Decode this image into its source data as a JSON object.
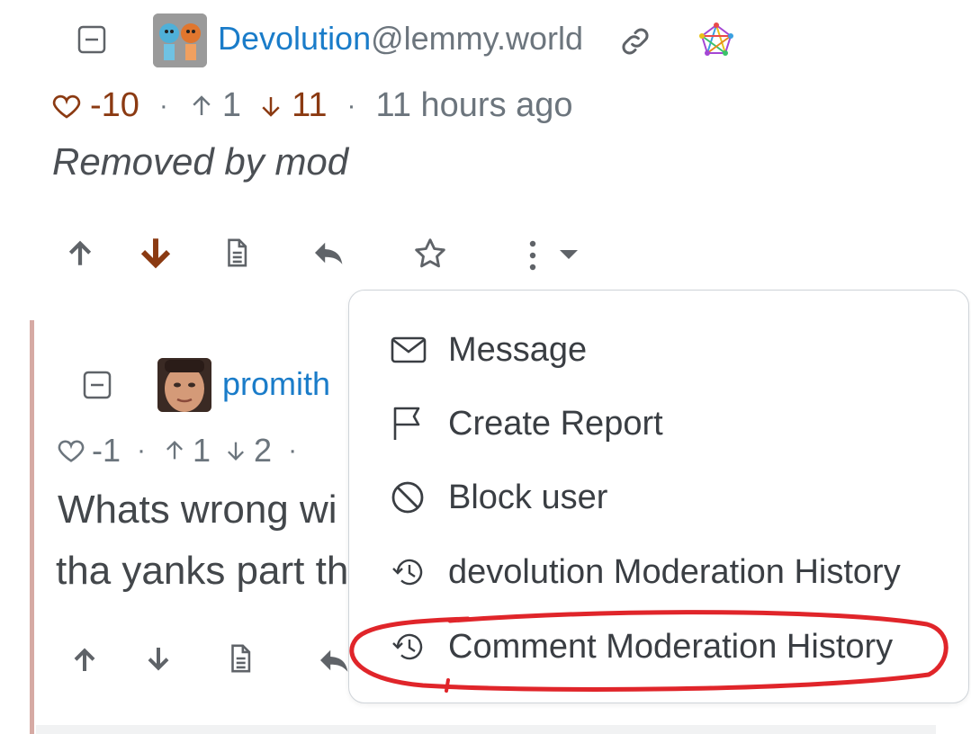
{
  "comment1": {
    "username": "Devolution",
    "userhost": "@lemmy.world",
    "score": "-10",
    "upvotes": "1",
    "downvotes": "11",
    "time": "11 hours ago",
    "body": "Removed by mod"
  },
  "comment2": {
    "username": "promith",
    "score": "-1",
    "upvotes": "1",
    "downvotes": "2",
    "body_line1": "Whats wrong wi",
    "body_line2": "tha yanks part th"
  },
  "dropdown": {
    "items": [
      {
        "label": "Message",
        "icon": "envelope-icon"
      },
      {
        "label": "Create Report",
        "icon": "flag-icon"
      },
      {
        "label": "Block user",
        "icon": "block-icon"
      },
      {
        "label": "devolution Moderation History",
        "icon": "history-icon"
      },
      {
        "label": "Comment Moderation History",
        "icon": "history-icon"
      }
    ]
  },
  "colors": {
    "accent": "#1a7cc9",
    "downvote_active": "#8b3a12",
    "highlight_circle": "#e0252a",
    "thread_bar": "#d6aaa4"
  }
}
